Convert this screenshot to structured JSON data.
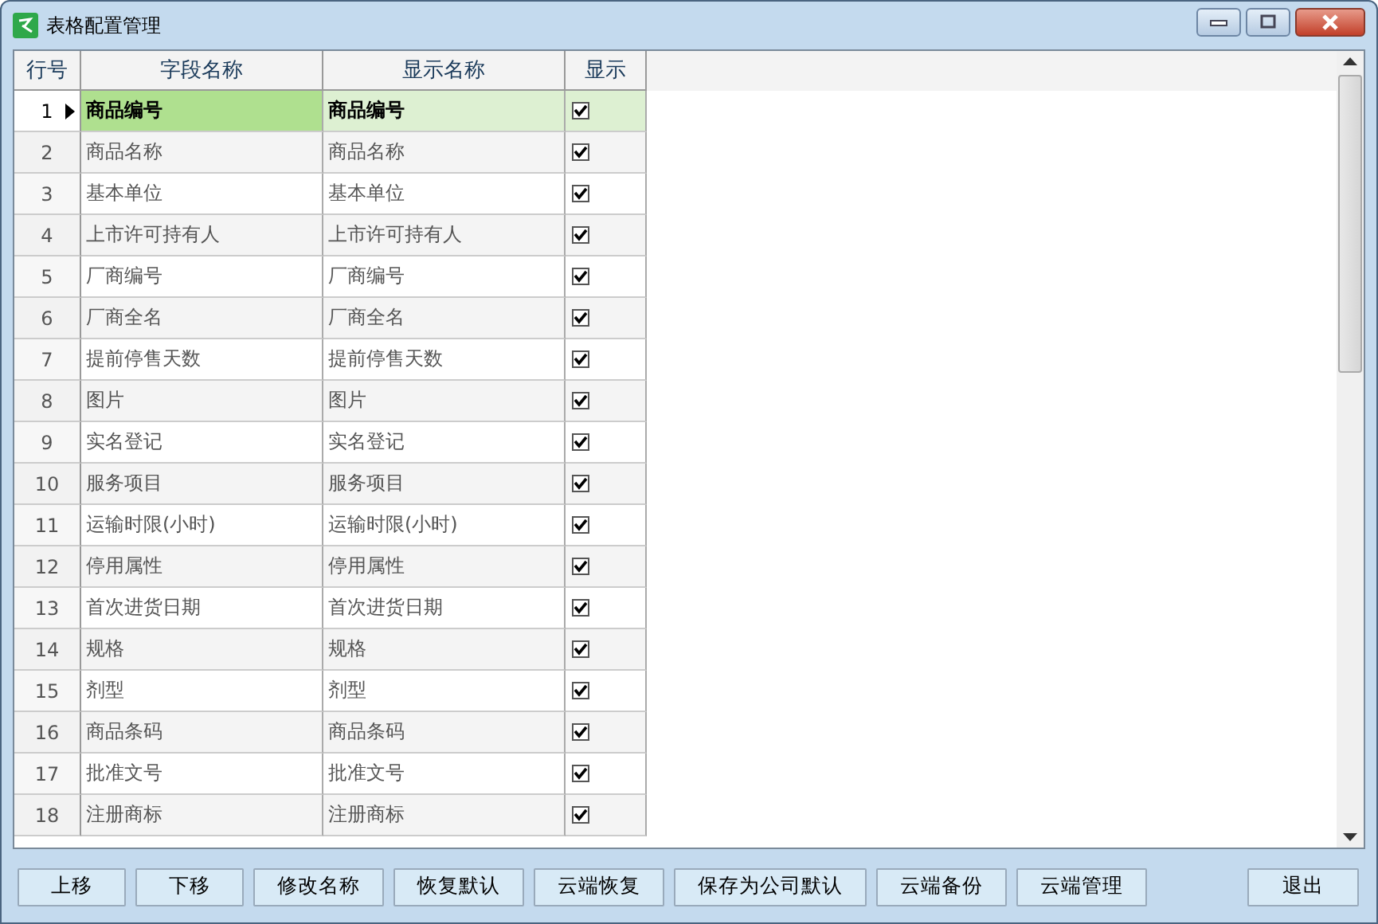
{
  "window": {
    "title": "表格配置管理"
  },
  "table": {
    "columns": [
      "行号",
      "字段名称",
      "显示名称",
      "显示"
    ],
    "rows": [
      {
        "index": "1",
        "field": "商品编号",
        "display": "商品编号",
        "shown": true,
        "selected": true
      },
      {
        "index": "2",
        "field": "商品名称",
        "display": "商品名称",
        "shown": true,
        "selected": false
      },
      {
        "index": "3",
        "field": "基本单位",
        "display": "基本单位",
        "shown": true,
        "selected": false
      },
      {
        "index": "4",
        "field": "上市许可持有人",
        "display": "上市许可持有人",
        "shown": true,
        "selected": false
      },
      {
        "index": "5",
        "field": "厂商编号",
        "display": "厂商编号",
        "shown": true,
        "selected": false
      },
      {
        "index": "6",
        "field": "厂商全名",
        "display": "厂商全名",
        "shown": true,
        "selected": false
      },
      {
        "index": "7",
        "field": "提前停售天数",
        "display": "提前停售天数",
        "shown": true,
        "selected": false
      },
      {
        "index": "8",
        "field": "图片",
        "display": "图片",
        "shown": true,
        "selected": false
      },
      {
        "index": "9",
        "field": "实名登记",
        "display": "实名登记",
        "shown": true,
        "selected": false
      },
      {
        "index": "10",
        "field": "服务项目",
        "display": "服务项目",
        "shown": true,
        "selected": false
      },
      {
        "index": "11",
        "field": "运输时限(小时)",
        "display": "运输时限(小时)",
        "shown": true,
        "selected": false
      },
      {
        "index": "12",
        "field": "停用属性",
        "display": "停用属性",
        "shown": true,
        "selected": false
      },
      {
        "index": "13",
        "field": "首次进货日期",
        "display": "首次进货日期",
        "shown": true,
        "selected": false
      },
      {
        "index": "14",
        "field": "规格",
        "display": "规格",
        "shown": true,
        "selected": false
      },
      {
        "index": "15",
        "field": "剂型",
        "display": "剂型",
        "shown": true,
        "selected": false
      },
      {
        "index": "16",
        "field": "商品条码",
        "display": "商品条码",
        "shown": true,
        "selected": false
      },
      {
        "index": "17",
        "field": "批准文号",
        "display": "批准文号",
        "shown": true,
        "selected": false
      },
      {
        "index": "18",
        "field": "注册商标",
        "display": "注册商标",
        "shown": true,
        "selected": false
      }
    ]
  },
  "buttons": [
    "上移",
    "下移",
    "修改名称",
    "恢复默认",
    "云端恢复",
    "保存为公司默认",
    "云端备份",
    "云端管理"
  ],
  "exit_button": "退出"
}
